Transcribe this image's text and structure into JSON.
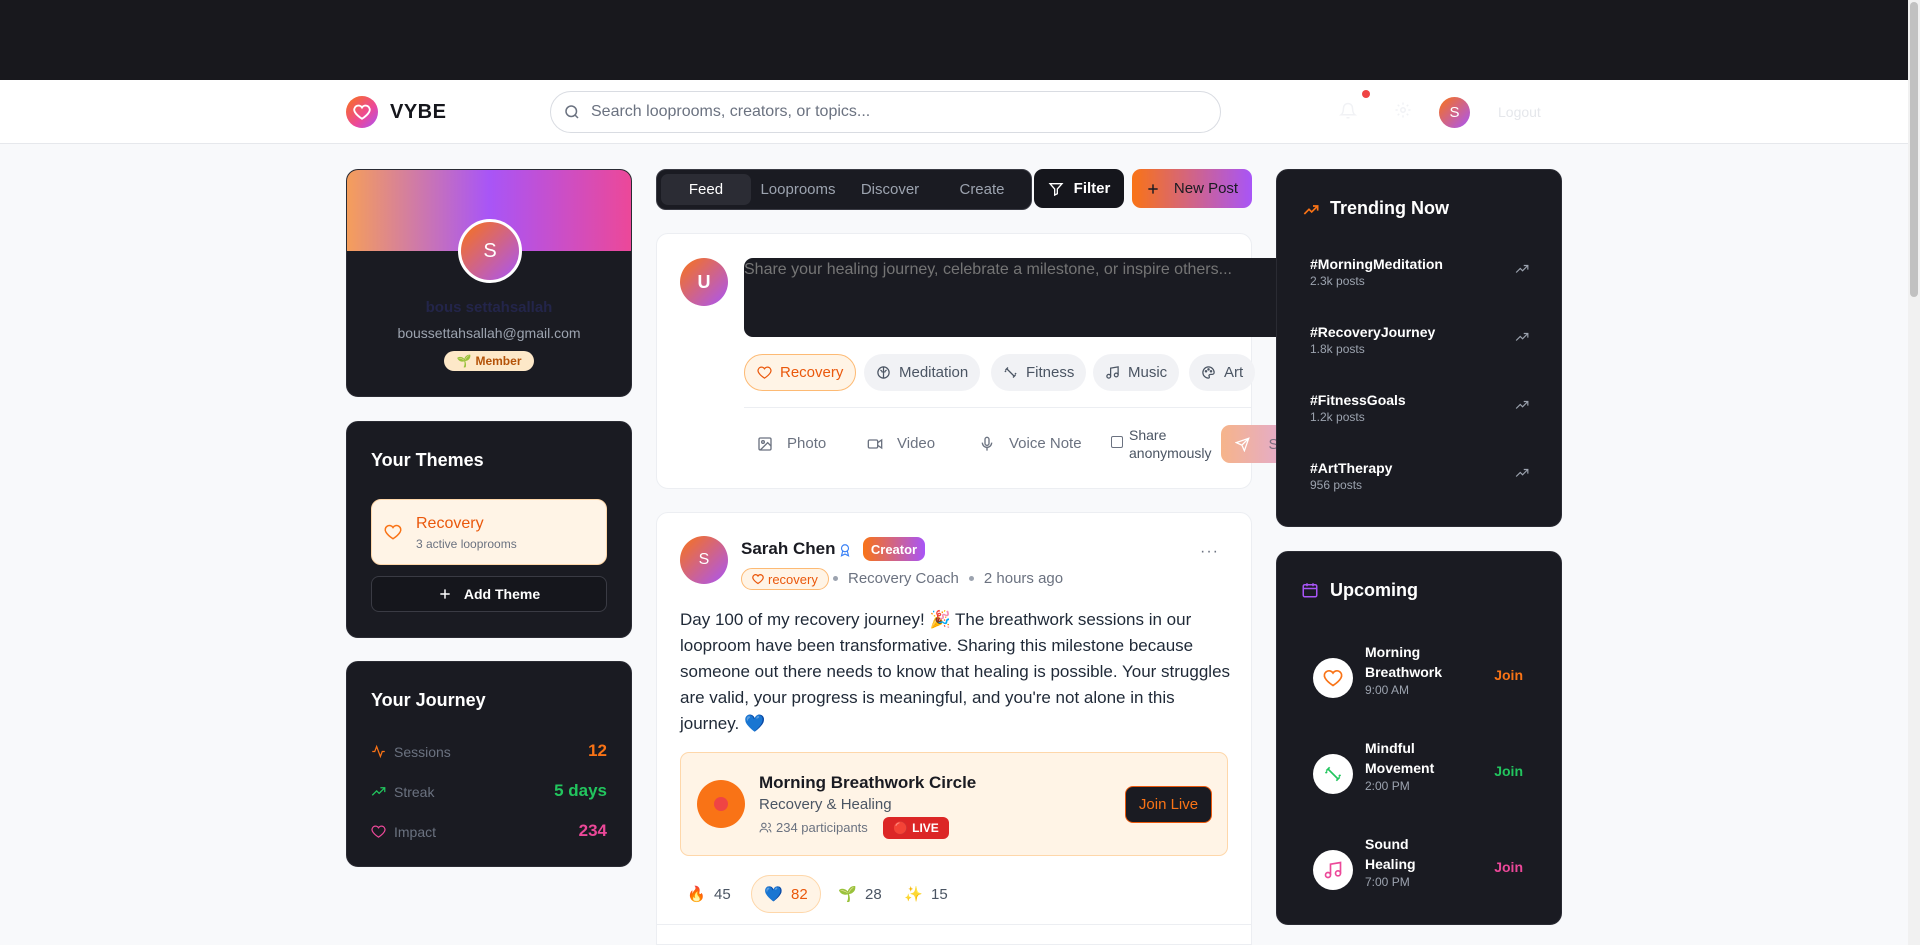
{
  "app": {
    "name": "VYBE",
    "logout_label": "Logout"
  },
  "search": {
    "placeholder": "Search looprooms, creators, or topics..."
  },
  "profile": {
    "avatar_letter": "S",
    "name": "bous settahsallah",
    "email": "boussettahsallah@gmail.com",
    "badge": "Member",
    "badge_emoji": "🌱"
  },
  "themes": {
    "title": "Your Themes",
    "items": [
      {
        "name": "Recovery",
        "sub": "3 active looprooms"
      }
    ],
    "add_label": "Add Theme"
  },
  "journey": {
    "title": "Your Journey",
    "stats": [
      {
        "label": "Sessions",
        "value": "12",
        "color": "#f97316"
      },
      {
        "label": "Streak",
        "value": "5 days",
        "color": "#22c55e"
      },
      {
        "label": "Impact",
        "value": "234",
        "color": "#ec4899"
      }
    ]
  },
  "nav": {
    "tabs": [
      "Feed",
      "Looprooms",
      "Discover",
      "Create"
    ],
    "active": "Feed",
    "filter_label": "Filter",
    "new_post_label": "New Post"
  },
  "compose": {
    "avatar_letter": "U",
    "placeholder": "Share your healing journey, celebrate a milestone, or inspire others...",
    "chips": [
      "Recovery",
      "Meditation",
      "Fitness",
      "Music",
      "Art"
    ],
    "active_chip": "Recovery",
    "tools": [
      "Photo",
      "Video",
      "Voice Note"
    ],
    "anon_label": "Share anonymously",
    "share_label": "Share"
  },
  "post": {
    "avatar_letter": "S",
    "author": "Sarah Chen",
    "badge": "Creator",
    "tag": "recovery",
    "role": "Recovery Coach",
    "time": "2 hours ago",
    "body": "Day 100 of my recovery journey! 🎉 The breathwork sessions in our looproom have been transformative. Sharing this milestone because someone out there needs to know that healing is possible. Your struggles are valid, your progress is meaningful, and you're not alone in this journey. 💙",
    "live": {
      "title": "Morning Breathwork Circle",
      "sub": "Recovery & Healing",
      "participants": "234 participants",
      "live_label": "LIVE",
      "join_label": "Join Live"
    },
    "reactions": [
      {
        "emoji": "🔥",
        "count": "45"
      },
      {
        "emoji": "💙",
        "count": "82"
      },
      {
        "emoji": "🌱",
        "count": "28"
      },
      {
        "emoji": "✨",
        "count": "15"
      }
    ]
  },
  "trending": {
    "title": "Trending Now",
    "items": [
      {
        "tag": "#MorningMeditation",
        "count": "2.3k posts"
      },
      {
        "tag": "#RecoveryJourney",
        "count": "1.8k posts"
      },
      {
        "tag": "#FitnessGoals",
        "count": "1.2k posts"
      },
      {
        "tag": "#ArtTherapy",
        "count": "956 posts"
      }
    ]
  },
  "upcoming": {
    "title": "Upcoming",
    "items": [
      {
        "title": "Morning Breathwork",
        "time": "9:00 AM",
        "join": "Join",
        "color": "#f97316",
        "icon": "heart-icon"
      },
      {
        "title": "Mindful Movement",
        "time": "2:00 PM",
        "join": "Join",
        "color": "#22c55e",
        "icon": "dumbbell-icon"
      },
      {
        "title": "Sound Healing",
        "time": "7:00 PM",
        "join": "Join",
        "color": "#ec4899",
        "icon": "music-icon"
      }
    ]
  }
}
